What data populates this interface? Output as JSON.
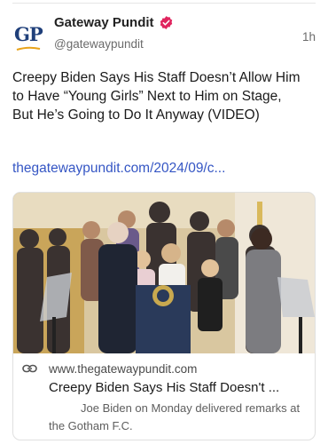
{
  "post": {
    "author_name": "Gateway Pundit",
    "author_handle": "@gatewaypundit",
    "avatar_text": "GP",
    "verified_icon": "verified-badge-icon",
    "timestamp": "1h",
    "body": "Creepy Biden Says His Staff Doesn’t Allow Him to Have “Young Girls” Next to Him on Stage, But He’s Going to Do It Anyway (VIDEO)",
    "link_text": "thegatewaypundit.com/2024/09/c..."
  },
  "link_card": {
    "link_icon": "link-icon",
    "domain": "www.thegatewaypundit.com",
    "title": "Creepy Biden Says His Staff Doesn't ...",
    "description": "Joe Biden on Monday delivered remarks at the Gotham F.C."
  },
  "colors": {
    "link": "#3556c4",
    "verified": "#e0245e",
    "avatar_brand": "#1f3f7a",
    "swoosh": "#e8a31a"
  }
}
